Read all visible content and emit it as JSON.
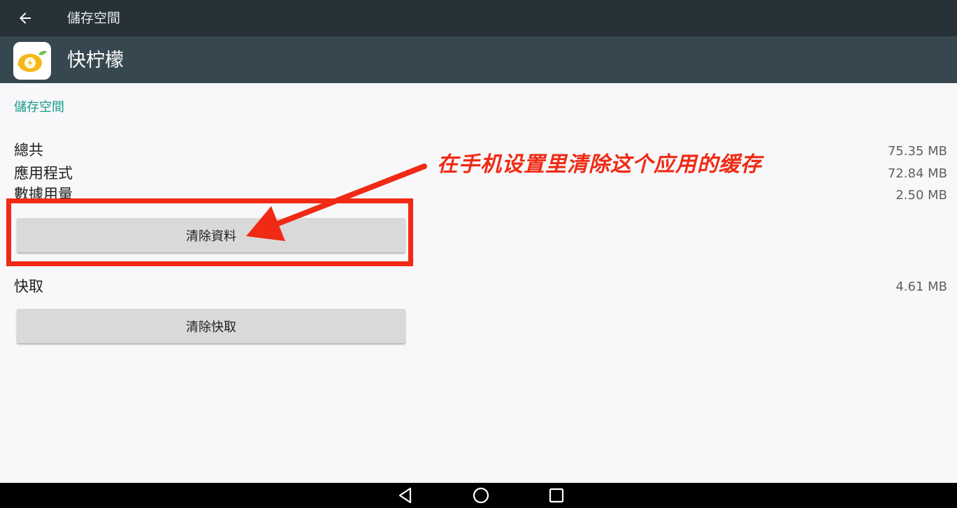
{
  "toolbar": {
    "title": "儲存空間",
    "back_icon": "arrow-back-icon"
  },
  "app": {
    "name": "快柠檬",
    "icon": "lemon-app-icon"
  },
  "storage": {
    "section_title": "儲存空間",
    "total_label": "總共",
    "total_value": "75.35 MB",
    "apps_label": "應用程式",
    "apps_value": "72.84 MB",
    "data_label": "數據用量",
    "data_value": "2.50 MB",
    "clear_data_button": "清除資料"
  },
  "cache": {
    "label": "快取",
    "value": "4.61 MB",
    "clear_cache_button": "清除快取"
  },
  "annotation": {
    "text": "在手机设置里清除这个应用的缓存",
    "color": "#f02a14"
  },
  "navbar": {
    "back_icon": "nav-back-icon",
    "home_icon": "nav-home-icon",
    "recents_icon": "nav-recents-icon"
  },
  "colors": {
    "toolbar": "#263238",
    "app_header": "#37474f",
    "accent": "#1a9a8c"
  }
}
